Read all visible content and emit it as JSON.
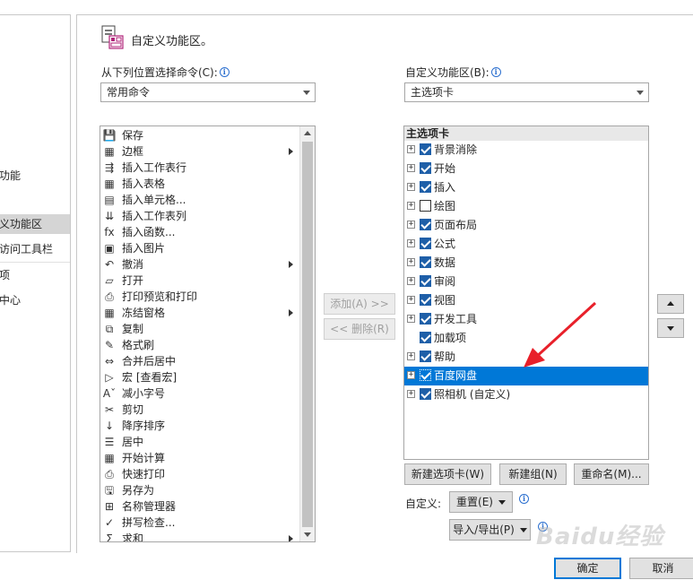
{
  "left_nav": {
    "items": [
      {
        "label": "功能",
        "selected": false
      },
      {
        "label": "义功能区",
        "selected": true
      },
      {
        "label": "访问工具栏",
        "selected": false
      },
      {
        "label": "项",
        "selected": false
      },
      {
        "label": "中心",
        "selected": false
      }
    ]
  },
  "header": {
    "title": "自定义功能区。",
    "icon": "customize-ribbon-icon"
  },
  "commands_from": {
    "label": "从下列位置选择命令(C):",
    "info": "i",
    "value": "常用命令"
  },
  "customize_ribbon": {
    "label": "自定义功能区(B):",
    "info": "i",
    "value": "主选项卡"
  },
  "command_list": [
    {
      "label": "保存",
      "icon": "save-icon",
      "glyph": "💾",
      "submenu": false
    },
    {
      "label": "边框",
      "icon": "border-icon",
      "glyph": "▦",
      "submenu": true
    },
    {
      "label": "插入工作表行",
      "icon": "insert-rows-icon",
      "glyph": "⇶",
      "submenu": false
    },
    {
      "label": "插入表格",
      "icon": "table-icon",
      "glyph": "▦",
      "submenu": false
    },
    {
      "label": "插入单元格...",
      "icon": "insert-cells-icon",
      "glyph": "▤",
      "submenu": false
    },
    {
      "label": "插入工作表列",
      "icon": "insert-columns-icon",
      "glyph": "⇊",
      "submenu": false
    },
    {
      "label": "插入函数...",
      "icon": "function-icon",
      "glyph": "fx",
      "submenu": false
    },
    {
      "label": "插入图片",
      "icon": "picture-icon",
      "glyph": "▣",
      "submenu": false
    },
    {
      "label": "撤消",
      "icon": "undo-icon",
      "glyph": "↶",
      "submenu": true
    },
    {
      "label": "打开",
      "icon": "open-folder-icon",
      "glyph": "▱",
      "submenu": false
    },
    {
      "label": "打印预览和打印",
      "icon": "print-preview-icon",
      "glyph": "⎙",
      "submenu": false
    },
    {
      "label": "冻结窗格",
      "icon": "freeze-panes-icon",
      "glyph": "▦",
      "submenu": true
    },
    {
      "label": "复制",
      "icon": "copy-icon",
      "glyph": "⧉",
      "submenu": false
    },
    {
      "label": "格式刷",
      "icon": "format-painter-icon",
      "glyph": "✎",
      "submenu": false
    },
    {
      "label": "合并后居中",
      "icon": "merge-center-icon",
      "glyph": "⇔",
      "submenu": false
    },
    {
      "label": "宏 [查看宏]",
      "icon": "macro-icon",
      "glyph": "▷",
      "submenu": false
    },
    {
      "label": "减小字号",
      "icon": "decrease-font-icon",
      "glyph": "Aˇ",
      "submenu": false
    },
    {
      "label": "剪切",
      "icon": "cut-icon",
      "glyph": "✂",
      "submenu": false
    },
    {
      "label": "降序排序",
      "icon": "sort-descending-icon",
      "glyph": "↓",
      "submenu": false
    },
    {
      "label": "居中",
      "icon": "align-center-icon",
      "glyph": "☰",
      "submenu": false
    },
    {
      "label": "开始计算",
      "icon": "calculate-icon",
      "glyph": "▦",
      "submenu": false
    },
    {
      "label": "快速打印",
      "icon": "quick-print-icon",
      "glyph": "⎙",
      "submenu": false
    },
    {
      "label": "另存为",
      "icon": "save-as-icon",
      "glyph": "🖫",
      "submenu": false
    },
    {
      "label": "名称管理器",
      "icon": "name-manager-icon",
      "glyph": "⊞",
      "submenu": false
    },
    {
      "label": "拼写检查...",
      "icon": "spell-check-icon",
      "glyph": "✓",
      "submenu": false
    },
    {
      "label": "求和",
      "icon": "sum-icon",
      "glyph": "Σ",
      "submenu": true
    }
  ],
  "middle_buttons": {
    "add": "添加(A) >>",
    "remove": "<< 删除(R)"
  },
  "tree": {
    "header": "主选项卡",
    "rows": [
      {
        "label": "背景消除",
        "checked": true,
        "expander": "+",
        "selected": false
      },
      {
        "label": "开始",
        "checked": true,
        "expander": "+",
        "selected": false
      },
      {
        "label": "插入",
        "checked": true,
        "expander": "+",
        "selected": false
      },
      {
        "label": "绘图",
        "checked": false,
        "expander": "+",
        "selected": false
      },
      {
        "label": "页面布局",
        "checked": true,
        "expander": "+",
        "selected": false
      },
      {
        "label": "公式",
        "checked": true,
        "expander": "+",
        "selected": false
      },
      {
        "label": "数据",
        "checked": true,
        "expander": "+",
        "selected": false
      },
      {
        "label": "审阅",
        "checked": true,
        "expander": "+",
        "selected": false
      },
      {
        "label": "视图",
        "checked": true,
        "expander": "+",
        "selected": false
      },
      {
        "label": "开发工具",
        "checked": true,
        "expander": "+",
        "selected": false
      },
      {
        "label": "加载项",
        "checked": true,
        "expander": "",
        "selected": false
      },
      {
        "label": "帮助",
        "checked": true,
        "expander": "+",
        "selected": false
      },
      {
        "label": "百度网盘",
        "checked": true,
        "expander": "+",
        "selected": true
      },
      {
        "label": "照相机 (自定义)",
        "checked": true,
        "expander": "+",
        "selected": false
      }
    ]
  },
  "tree_buttons": {
    "new_tab": "新建选项卡(W)",
    "new_group": "新建组(N)",
    "rename": "重命名(M)..."
  },
  "customizations": {
    "label": "自定义:",
    "reset": "重置(E)",
    "import_export": "导入/导出(P)",
    "info": "i"
  },
  "footer": {
    "ok": "确定",
    "cancel": "取消"
  },
  "watermark": "Baidu经验",
  "colors": {
    "accent": "#0078d7",
    "annotation_arrow": "#e8202a",
    "checkbox": "#1e5fa8"
  }
}
